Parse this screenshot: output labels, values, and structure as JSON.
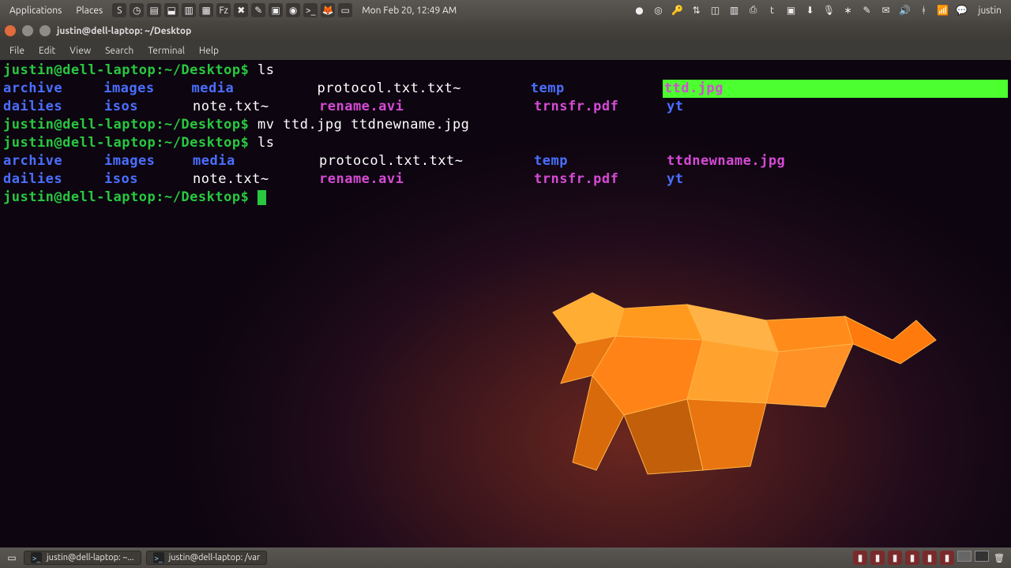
{
  "top_panel": {
    "menus": [
      "Applications",
      "Places"
    ],
    "clock": "Mon Feb 20, 12:49 AM",
    "user": "justin",
    "ql_icons": [
      "skype-icon",
      "clock-icon",
      "monitor-icon",
      "dropbox-icon",
      "document-icon",
      "files-icon",
      "filezilla-icon",
      "transmission-icon",
      "notes-icon",
      "folder-icon",
      "chrome-icon",
      "terminal-icon",
      "firefox-icon",
      "desktop-icon"
    ],
    "right_icons": [
      "record-icon",
      "chromium-icon",
      "keepass-icon",
      "network-icon",
      "app-icon",
      "doc-icon",
      "printer-icon",
      "twitter-icon",
      "folder-icon",
      "download-icon",
      "mic-icon",
      "bluetooth-icon",
      "edit-icon",
      "mail-icon",
      "volume-icon",
      "bt-icon",
      "wifi-icon",
      "chat-icon"
    ]
  },
  "window": {
    "title": "justin@dell-laptop: ~/Desktop",
    "menus": [
      "File",
      "Edit",
      "View",
      "Search",
      "Terminal",
      "Help"
    ]
  },
  "terminal": {
    "prompt": "justin@dell-laptop:~/Desktop$",
    "lines": [
      {
        "type": "cmd",
        "text": "ls"
      },
      {
        "type": "ls",
        "cols": [
          {
            "t": "archive",
            "k": "dir"
          },
          {
            "t": "images",
            "k": "dir"
          },
          {
            "t": "media",
            "k": "dir"
          },
          {
            "t": "protocol.txt.txt~",
            "k": "plain"
          },
          {
            "t": "temp",
            "k": "dir"
          },
          {
            "t": "ttd.jpg",
            "k": "file",
            "sel": true
          }
        ]
      },
      {
        "type": "ls",
        "cols": [
          {
            "t": "dailies",
            "k": "dir"
          },
          {
            "t": "isos",
            "k": "dir"
          },
          {
            "t": "note.txt~",
            "k": "plain"
          },
          {
            "t": "rename.avi",
            "k": "file"
          },
          {
            "t": "trnsfr.pdf",
            "k": "file"
          },
          {
            "t": "yt",
            "k": "dir"
          }
        ]
      },
      {
        "type": "cmd",
        "text": "mv ttd.jpg ttdnewname.jpg"
      },
      {
        "type": "cmd",
        "text": "ls"
      },
      {
        "type": "ls",
        "cols": [
          {
            "t": "archive",
            "k": "dir"
          },
          {
            "t": "images",
            "k": "dir"
          },
          {
            "t": "media",
            "k": "dir"
          },
          {
            "t": "protocol.txt.txt~",
            "k": "plain"
          },
          {
            "t": "temp",
            "k": "dir"
          },
          {
            "t": "ttdnewname.jpg",
            "k": "file"
          }
        ]
      },
      {
        "type": "ls",
        "cols": [
          {
            "t": "dailies",
            "k": "dir"
          },
          {
            "t": "isos",
            "k": "dir"
          },
          {
            "t": "note.txt~",
            "k": "plain"
          },
          {
            "t": "rename.avi",
            "k": "file"
          },
          {
            "t": "trnsfr.pdf",
            "k": "file"
          },
          {
            "t": "yt",
            "k": "dir"
          }
        ]
      },
      {
        "type": "prompt-only"
      }
    ]
  },
  "bottom_panel": {
    "tasks": [
      {
        "label": "justin@dell-laptop: ~..."
      },
      {
        "label": "justin@dell-laptop: /var"
      }
    ],
    "right_icons": [
      "app1-icon",
      "app2-icon",
      "app3-icon",
      "app4-icon",
      "app5-icon",
      "app6-icon"
    ]
  }
}
